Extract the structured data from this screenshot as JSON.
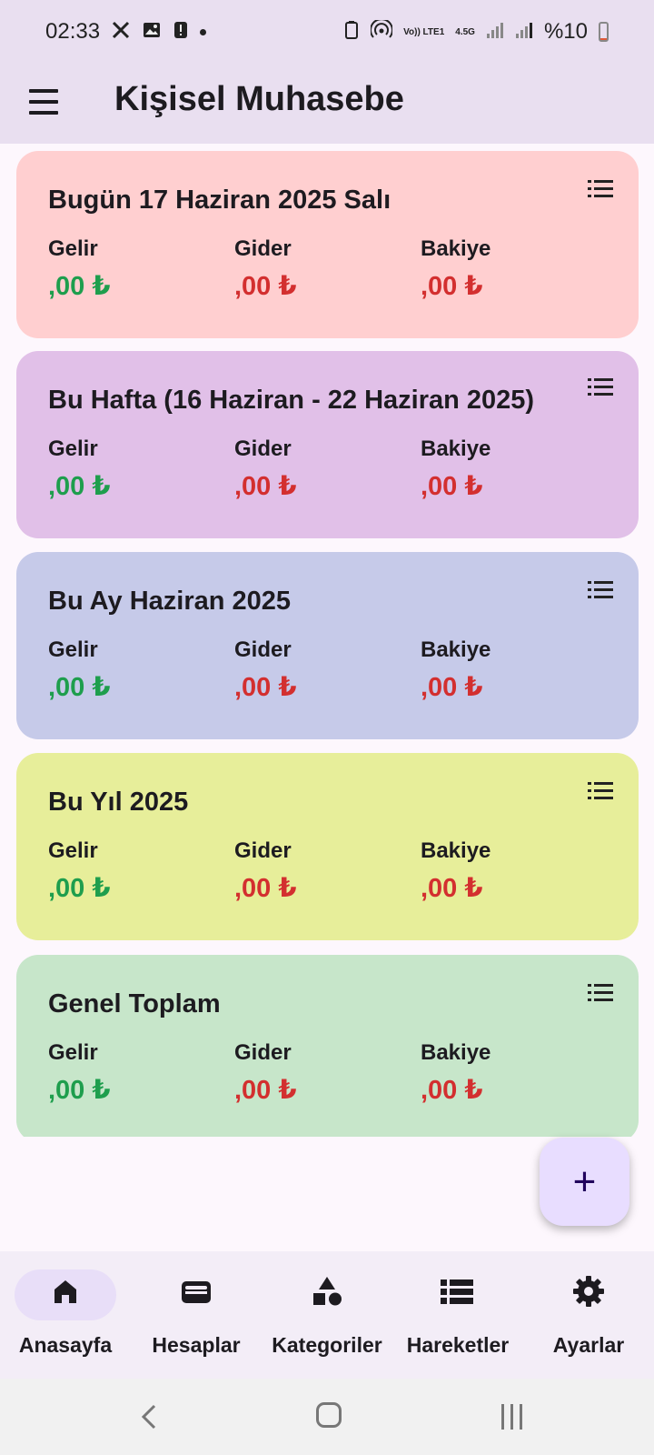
{
  "status_bar": {
    "time": "02:33",
    "battery": "%10",
    "network": [
      "Vo)) LTE1",
      "4.5G"
    ],
    "icons": [
      "x-icon",
      "image-icon",
      "alert-icon",
      "alarm-icon",
      "hotspot-icon",
      "signal-icon",
      "signal-icon"
    ]
  },
  "app_bar": {
    "title": "Kişisel Muhasebe"
  },
  "labels": {
    "income": "Gelir",
    "expense": "Gider",
    "balance": "Bakiye"
  },
  "cards": [
    {
      "title": "Bugün 17 Haziran 2025 Salı",
      "income": ",00 ₺",
      "expense": ",00 ₺",
      "balance": ",00 ₺",
      "color": "#ffcfd0"
    },
    {
      "title": "Bu Hafta (16 Haziran - 22 Haziran 2025)",
      "income": ",00 ₺",
      "expense": ",00 ₺",
      "balance": ",00 ₺",
      "color": "#e1c0e8"
    },
    {
      "title": "Bu Ay Haziran 2025",
      "income": ",00 ₺",
      "expense": ",00 ₺",
      "balance": ",00 ₺",
      "color": "#c6cae9"
    },
    {
      "title": "Bu Yıl 2025",
      "income": ",00 ₺",
      "expense": ",00 ₺",
      "balance": ",00 ₺",
      "color": "#e7ee9a"
    },
    {
      "title": "Genel Toplam",
      "income": ",00 ₺",
      "expense": ",00 ₺",
      "balance": ",00 ₺",
      "color": "#c7e6ca"
    }
  ],
  "colors": {
    "income": "#1e9e4d",
    "expense": "#d32f2f",
    "balance": "#d32f2f"
  },
  "fab": {
    "label": "+"
  },
  "bottom_nav": [
    {
      "label": "Anasayfa",
      "icon": "home-icon",
      "active": true
    },
    {
      "label": "Hesaplar",
      "icon": "wallet-icon",
      "active": false
    },
    {
      "label": "Kategoriler",
      "icon": "category-icon",
      "active": false
    },
    {
      "label": "Hareketler",
      "icon": "list-icon",
      "active": false
    },
    {
      "label": "Ayarlar",
      "icon": "gear-icon",
      "active": false
    }
  ]
}
